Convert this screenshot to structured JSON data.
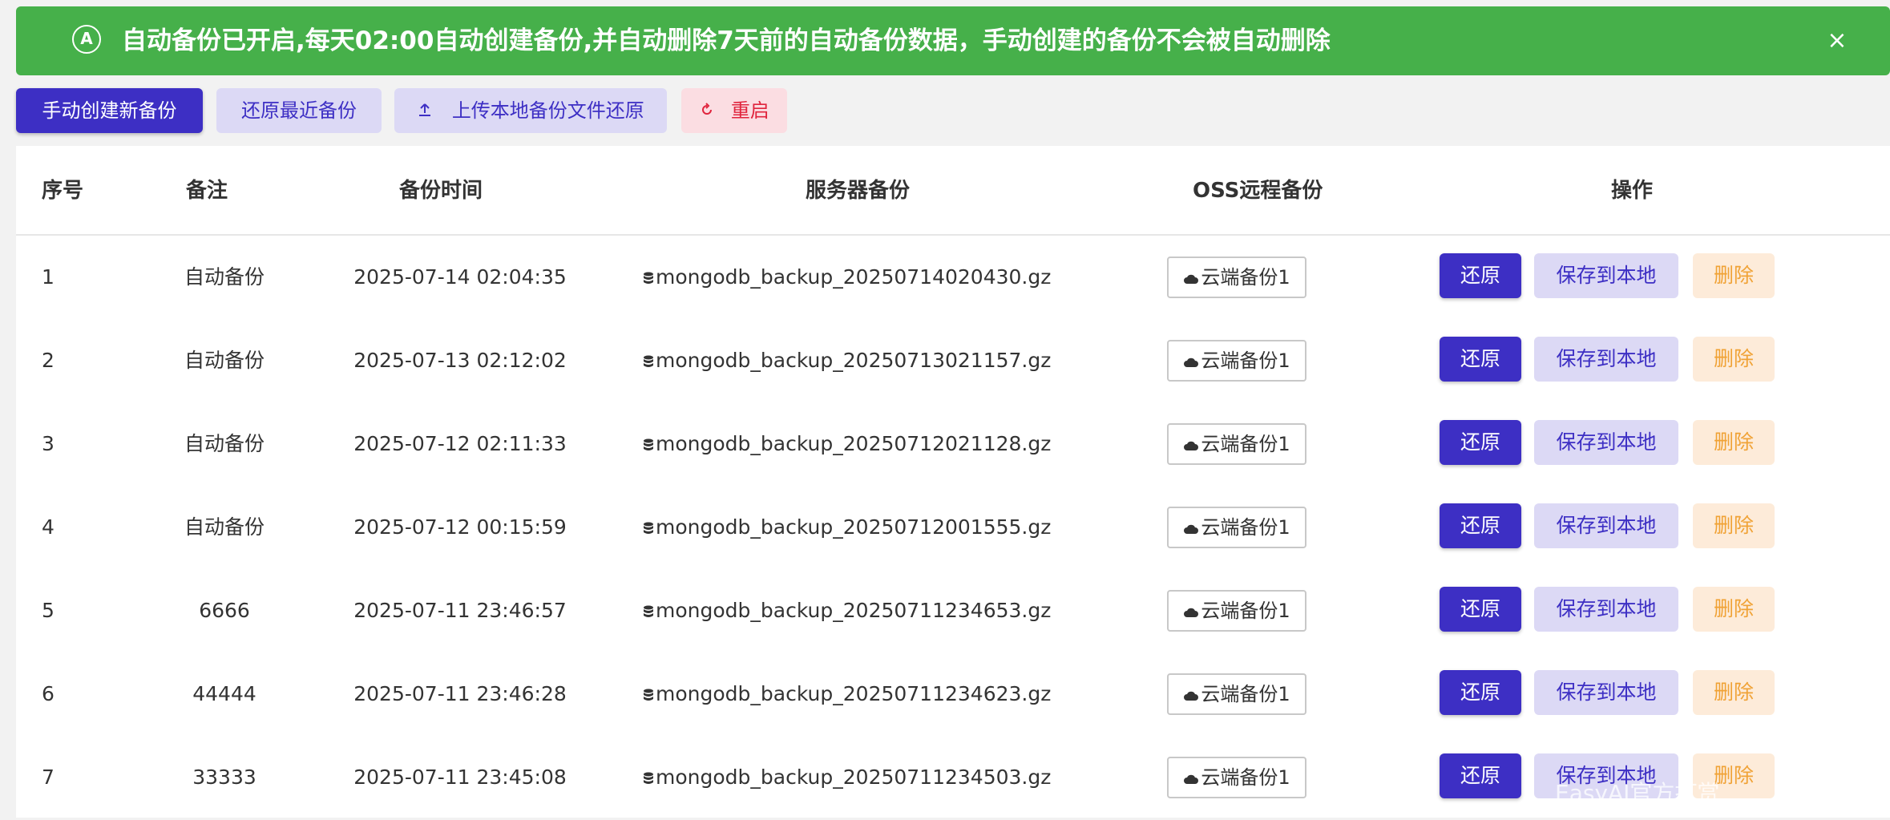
{
  "alert": {
    "icon_letter": "A",
    "text": "自动备份已开启,每天02:00自动创建备份,并自动删除7天前的自动备份数据，手动创建的备份不会被自动删除",
    "close": "×",
    "color": "#46b04a"
  },
  "toolbar": {
    "create_label": "手动创建新备份",
    "restore_latest_label": "还原最近备份",
    "upload_label": "上传本地备份文件还原",
    "restart_label": "重启"
  },
  "table": {
    "headers": [
      "序号",
      "备注",
      "备份时间",
      "服务器备份",
      "OSS远程备份",
      "操作"
    ],
    "rows": [
      {
        "idx": "1",
        "note": "自动备份",
        "time": "2025-07-14 02:04:35",
        "file": "mongodb_backup_20250714020430.gz",
        "oss": "云端备份1"
      },
      {
        "idx": "2",
        "note": "自动备份",
        "time": "2025-07-13 02:12:02",
        "file": "mongodb_backup_20250713021157.gz",
        "oss": "云端备份1"
      },
      {
        "idx": "3",
        "note": "自动备份",
        "time": "2025-07-12 02:11:33",
        "file": "mongodb_backup_20250712021128.gz",
        "oss": "云端备份1"
      },
      {
        "idx": "4",
        "note": "自动备份",
        "time": "2025-07-12 00:15:59",
        "file": "mongodb_backup_20250712001555.gz",
        "oss": "云端备份1"
      },
      {
        "idx": "5",
        "note": "6666",
        "time": "2025-07-11 23:46:57",
        "file": "mongodb_backup_20250711234653.gz",
        "oss": "云端备份1"
      },
      {
        "idx": "6",
        "note": "44444",
        "time": "2025-07-11 23:46:28",
        "file": "mongodb_backup_20250711234623.gz",
        "oss": "云端备份1"
      },
      {
        "idx": "7",
        "note": "33333",
        "time": "2025-07-11 23:45:08",
        "file": "mongodb_backup_20250711234503.gz",
        "oss": "云端备份1"
      }
    ],
    "actions": {
      "restore": "还原",
      "save_local": "保存到本地",
      "delete": "删除"
    }
  },
  "watermark": "EasyAI官方打赏",
  "colors": {
    "primary": "#3d2fc4",
    "soft": "#dcd9f5",
    "danger": "#e0243d",
    "warning": "#f0a235"
  },
  "icons": {
    "alert": "auto-icon",
    "upload": "upload-icon",
    "restart": "refresh-icon",
    "file": "database-icon",
    "oss": "cloud-icon",
    "close": "close-icon"
  }
}
